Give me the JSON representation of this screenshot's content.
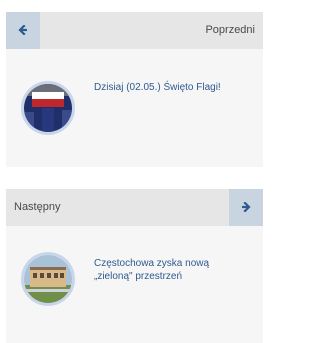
{
  "prev": {
    "label": "Poprzedni",
    "arrow_icon": "arrow-left-icon",
    "title": "Dzisiaj (02.05.) Święto Flagi!",
    "thumb_icon": "flag-photo"
  },
  "next": {
    "label": "Następny",
    "arrow_icon": "arrow-right-icon",
    "title": "Częstochowa zyska nową „zieloną\" przestrzeń",
    "thumb_icon": "building-photo"
  },
  "colors": {
    "accent": "#2f5a8f",
    "bar": "#e6e6e6",
    "arrow_box": "#c8d4e0",
    "panel": "#f6f6f6",
    "thumb_border": "#c9d6ea"
  }
}
